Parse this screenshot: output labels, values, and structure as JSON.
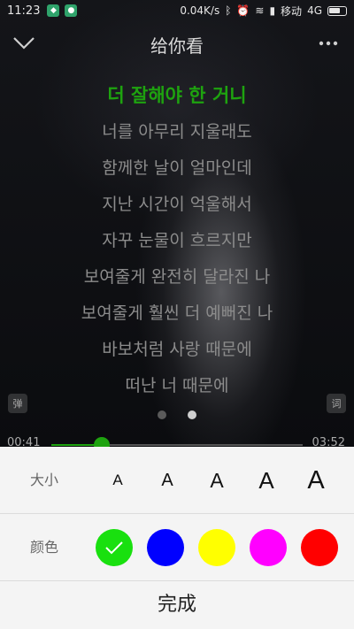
{
  "status_bar": {
    "time": "11:23",
    "speed": "0.04K/s",
    "carrier": "移动",
    "network": "4G"
  },
  "header": {
    "title": "给你看"
  },
  "lyrics": {
    "current": "더 잘해야 한 거니",
    "lines": [
      "너를 아무리 지울래도",
      "함께한 날이 얼마인데",
      "지난 시간이 억울해서",
      "자꾸 눈물이 흐르지만",
      "보여줄게 완전히 달라진 나",
      "보여줄게 훨씬 더 예뻐진 나",
      "바보처럼 사랑 때문에",
      "떠난 너 때문에"
    ]
  },
  "side_buttons": {
    "danmu": "弹",
    "lyric": "词"
  },
  "progress": {
    "current": "00:41",
    "total": "03:52",
    "fraction": 0.2
  },
  "settings": {
    "size_label": "大小",
    "size_options": [
      "A",
      "A",
      "A",
      "A",
      "A"
    ],
    "selected_size": 2,
    "color_label": "颜色",
    "colors": [
      "#19e00f",
      "#0000ff",
      "#ffff00",
      "#ff00ff",
      "#ff0000"
    ],
    "selected_color": 0,
    "done_label": "完成"
  }
}
